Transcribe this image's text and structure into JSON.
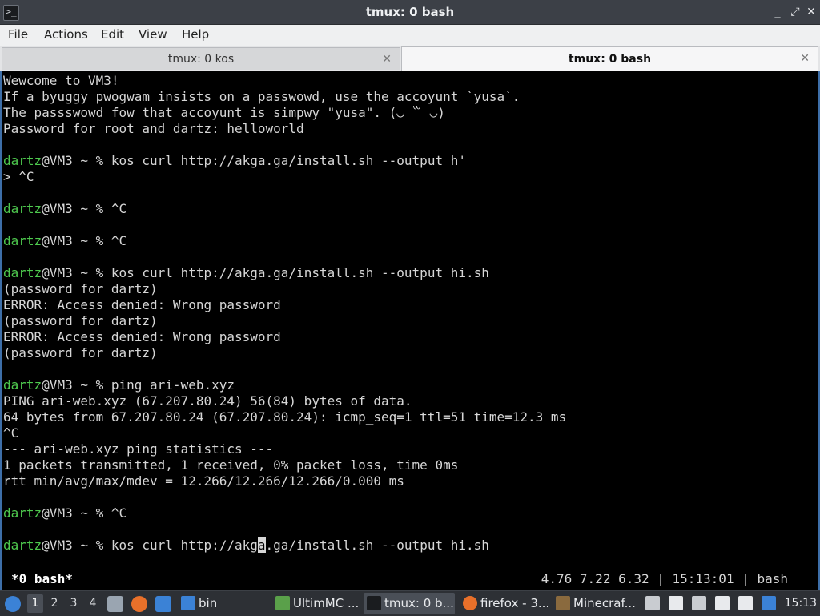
{
  "window": {
    "title": "tmux: 0 bash",
    "minimize_glyph": "_",
    "maximize_glyph": "⤢",
    "close_glyph": "✕"
  },
  "menu": [
    "File",
    "Actions",
    "Edit",
    "View",
    "Help"
  ],
  "tabs": [
    {
      "label": "tmux: 0 kos",
      "active": false,
      "close": "✕"
    },
    {
      "label": "tmux: 0 bash",
      "active": true,
      "close": "✕"
    }
  ],
  "terminal": {
    "lines": [
      {
        "text": "Wewcome to VM3!"
      },
      {
        "text": "If a byuggy pwogwam insists on a passwowd, use the accoyunt `yusa`."
      },
      {
        "text": "The passswowd fow that accoyunt is simpwy \"yusa\". (◡ ꒳ ◡)"
      },
      {
        "text": "Password for root and dartz: helloworld"
      },
      {
        "text": ""
      },
      {
        "user": "dartz",
        "text": "@VM3 ~ % kos curl http://akga.ga/install.sh --output h'"
      },
      {
        "text": "> ^C"
      },
      {
        "text": ""
      },
      {
        "user": "dartz",
        "text": "@VM3 ~ % ^C"
      },
      {
        "text": ""
      },
      {
        "user": "dartz",
        "text": "@VM3 ~ % ^C"
      },
      {
        "text": ""
      },
      {
        "user": "dartz",
        "text": "@VM3 ~ % kos curl http://akga.ga/install.sh --output hi.sh"
      },
      {
        "text": "(password for dartz)"
      },
      {
        "text": "ERROR: Access denied: Wrong password"
      },
      {
        "text": "(password for dartz)"
      },
      {
        "text": "ERROR: Access denied: Wrong password"
      },
      {
        "text": "(password for dartz)"
      },
      {
        "text": ""
      },
      {
        "user": "dartz",
        "text": "@VM3 ~ % ping ari-web.xyz"
      },
      {
        "text": "PING ari-web.xyz (67.207.80.24) 56(84) bytes of data."
      },
      {
        "text": "64 bytes from 67.207.80.24 (67.207.80.24): icmp_seq=1 ttl=51 time=12.3 ms"
      },
      {
        "text": "^C"
      },
      {
        "text": "--- ari-web.xyz ping statistics ---"
      },
      {
        "text": "1 packets transmitted, 1 received, 0% packet loss, time 0ms"
      },
      {
        "text": "rtt min/avg/max/mdev = 12.266/12.266/12.266/0.000 ms"
      },
      {
        "text": ""
      },
      {
        "user": "dartz",
        "text": "@VM3 ~ % ^C"
      },
      {
        "text": ""
      },
      {
        "user": "dartz",
        "text": "@VM3 ~ % kos curl http://akg",
        "cursor": "a",
        "after": ".ga/install.sh --output hi.sh"
      }
    ],
    "status_left": "*0 bash*",
    "status_right": "4.76 7.22 6.32 | 15:13:01 | bash"
  },
  "taskbar": {
    "workspaces": [
      "1",
      "2",
      "3",
      "4"
    ],
    "active_workspace": "1",
    "launchers": [
      {
        "name": "file-manager-icon",
        "color": "#9aa5b1"
      },
      {
        "name": "firefox-icon",
        "color": "#e8702a"
      },
      {
        "name": "desktop-icon",
        "color": "#3b82d6"
      }
    ],
    "folder": {
      "label": "bin",
      "color": "#3b82d6"
    },
    "tasks": [
      {
        "label": "UltimMC ...",
        "icon": "ultimmc-icon",
        "color": "#5aa04a",
        "active": false
      },
      {
        "label": "tmux: 0 b...",
        "icon": "terminal-icon",
        "color": "#1a1c1f",
        "active": true
      },
      {
        "label": "firefox - 3...",
        "icon": "firefox-icon",
        "color": "#e8702a",
        "active": false
      },
      {
        "label": "Minecraf...",
        "icon": "minecraft-icon",
        "color": "#8a6a3e",
        "active": false
      }
    ],
    "tray": [
      {
        "name": "clipboard-icon",
        "color": "#c9ccd1"
      },
      {
        "name": "volume-icon",
        "color": "#e8eaed"
      },
      {
        "name": "network-icon",
        "color": "#c9ccd1"
      },
      {
        "name": "notes-icon",
        "color": "#e8eaed"
      },
      {
        "name": "user-icon",
        "color": "#e8eaed"
      },
      {
        "name": "updates-icon",
        "color": "#3b82d6"
      }
    ],
    "clock": "15:13"
  }
}
